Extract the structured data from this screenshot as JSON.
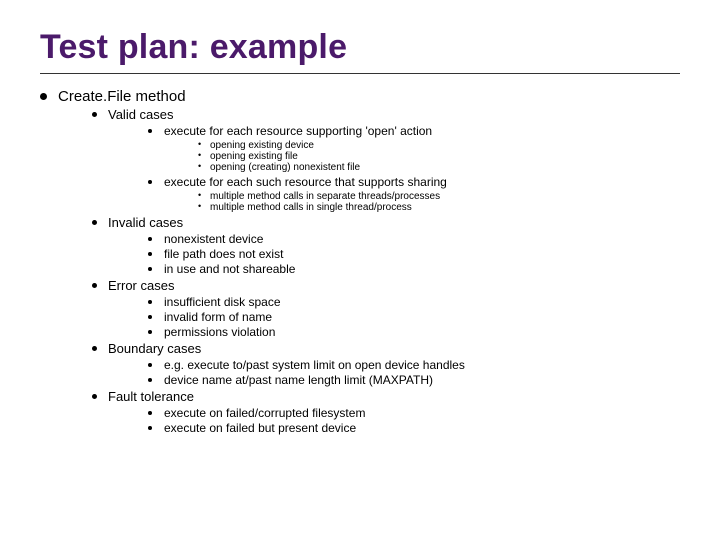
{
  "title": "Test plan: example",
  "l1_item": "Create.File method",
  "sections": [
    {
      "label": "Valid cases",
      "items": [
        {
          "text": "execute for each resource supporting 'open' action",
          "sub": [
            "opening existing device",
            "opening existing file",
            "opening (creating) nonexistent file"
          ]
        },
        {
          "text": "execute for each such resource that supports sharing",
          "sub": [
            "multiple method calls in separate threads/processes",
            "multiple method calls in single thread/process"
          ]
        }
      ]
    },
    {
      "label": "Invalid cases",
      "items": [
        {
          "text": "nonexistent device"
        },
        {
          "text": "file path does not exist"
        },
        {
          "text": "in use and not shareable"
        }
      ]
    },
    {
      "label": "Error cases",
      "items": [
        {
          "text": "insufficient disk space"
        },
        {
          "text": "invalid form of name"
        },
        {
          "text": "permissions violation"
        }
      ]
    },
    {
      "label": "Boundary cases",
      "items": [
        {
          "text": "e.g. execute to/past system limit on open device handles"
        },
        {
          "text": "device name at/past name length limit (MAXPATH)"
        }
      ]
    },
    {
      "label": "Fault tolerance",
      "items": [
        {
          "text": "execute on failed/corrupted filesystem"
        },
        {
          "text": "execute on failed but present device"
        }
      ]
    }
  ]
}
